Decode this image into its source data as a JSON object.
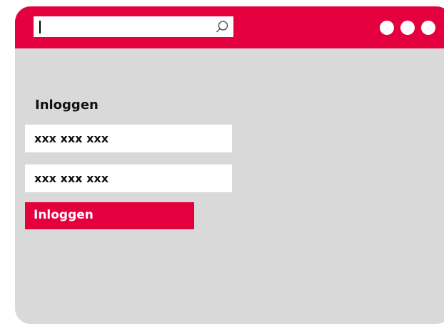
{
  "colors": {
    "brand": "#e4003f",
    "window_background": "#d9d9d9",
    "field_background": "#ffffff"
  },
  "address_bar": {
    "value": "",
    "icon": "search-icon"
  },
  "window_controls": {
    "icons": [
      "dot-icon",
      "dot-icon",
      "dot-icon"
    ]
  },
  "login": {
    "heading": "Inloggen",
    "username_value": "xxx xxx xxx",
    "password_value": "xxx xxx xxx",
    "button_label": "Inloggen"
  }
}
